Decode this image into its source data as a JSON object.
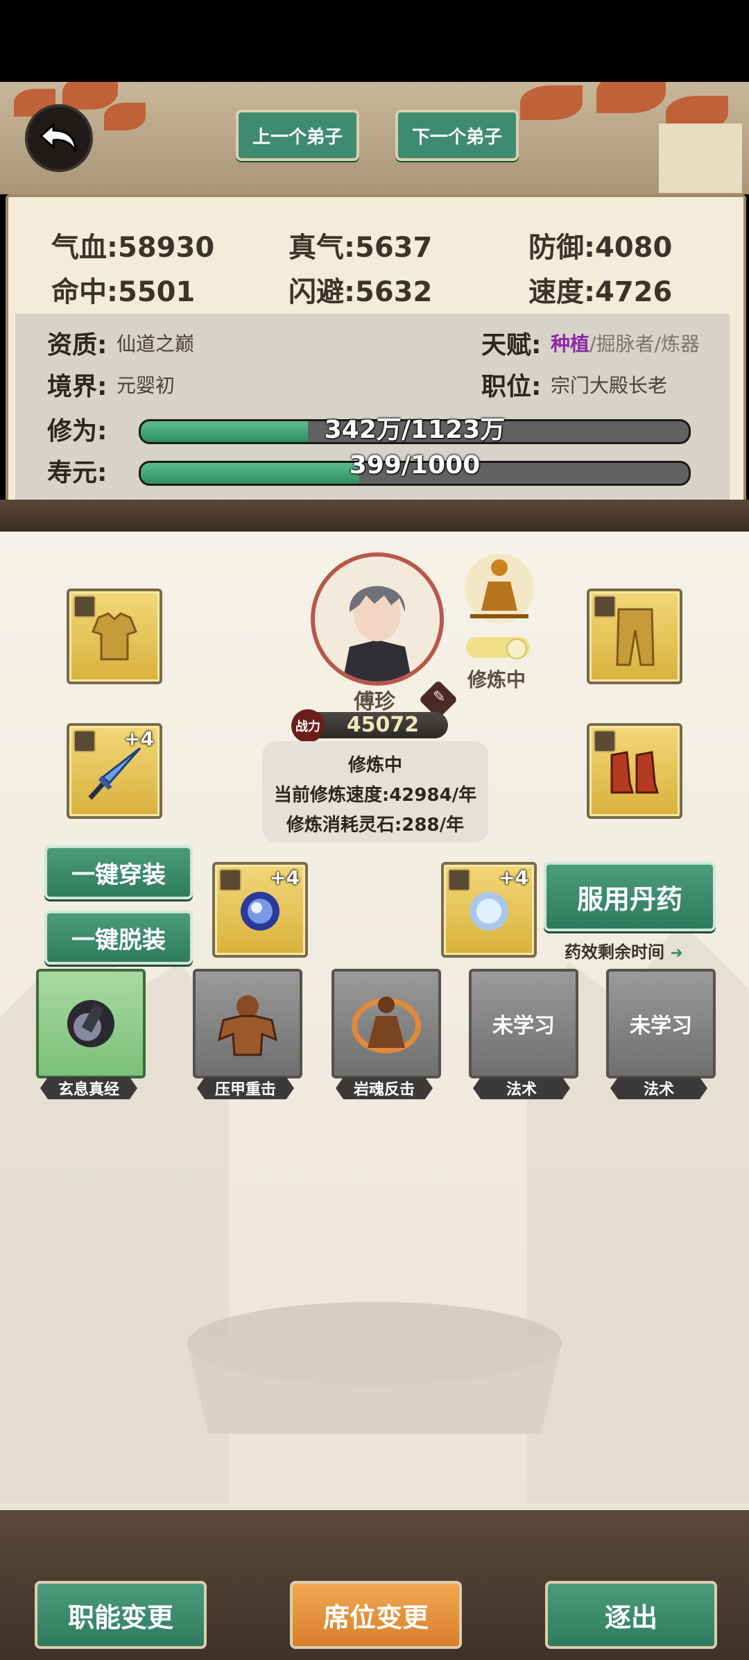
{
  "nav": {
    "prev_label": "上一个弟子",
    "next_label": "下一个弟子"
  },
  "stats": {
    "qixue": "气血:58930",
    "zhenqi": "真气:5637",
    "fangyu": "防御:4080",
    "mingzhong": "命中:5501",
    "shanbi": "闪避:5632",
    "sudu": "速度:4726"
  },
  "info": {
    "zizhi_label": "资质:",
    "zizhi_value": "仙道之巅",
    "jingjie_label": "境界:",
    "jingjie_value": "元婴初",
    "tianfu_label": "天赋:",
    "tianfu_values": [
      "种植",
      "/",
      "掘脉者",
      "/",
      "炼器"
    ],
    "zhiwei_label": "职位:",
    "zhiwei_value": "宗门大殿长老",
    "xiuwei_label": "修为:",
    "xiuwei_text": "342万/1123万",
    "xiuwei_progress": 0.305,
    "shouyuan_label": "寿元:",
    "shouyuan_text": "399/1000",
    "shouyuan_progress": 0.399
  },
  "character": {
    "name": "傅珍",
    "status": "修炼中",
    "power_label": "战力",
    "power": "45072"
  },
  "cultivation": {
    "title": "修炼中",
    "speed": "当前修炼速度:42984/年",
    "cost": "修炼消耗灵石:288/年"
  },
  "equipment": {
    "weapon_plus": "+4",
    "orb_left_plus": "+4",
    "orb_right_plus": "+4"
  },
  "buttons": {
    "equip_all": "一键穿装",
    "unequip_all": "一键脱装",
    "take_pill": "服用丹药",
    "pill_remaining": "药效剩余时间"
  },
  "skills": [
    {
      "label": "玄息真经",
      "text": ""
    },
    {
      "label": "压甲重击",
      "text": ""
    },
    {
      "label": "岩魂反击",
      "text": ""
    },
    {
      "label": "法术",
      "text": "未学习"
    },
    {
      "label": "法术",
      "text": "未学习"
    }
  ],
  "bottom": {
    "change_role": "职能变更",
    "change_seat": "席位变更",
    "expel": "逐出"
  },
  "colors": {
    "green_btn": "#3f8b6f",
    "gold_slot": "#e6c45a",
    "orange_btn": "#e5933f",
    "talent_purple": "#8a2aa8"
  }
}
